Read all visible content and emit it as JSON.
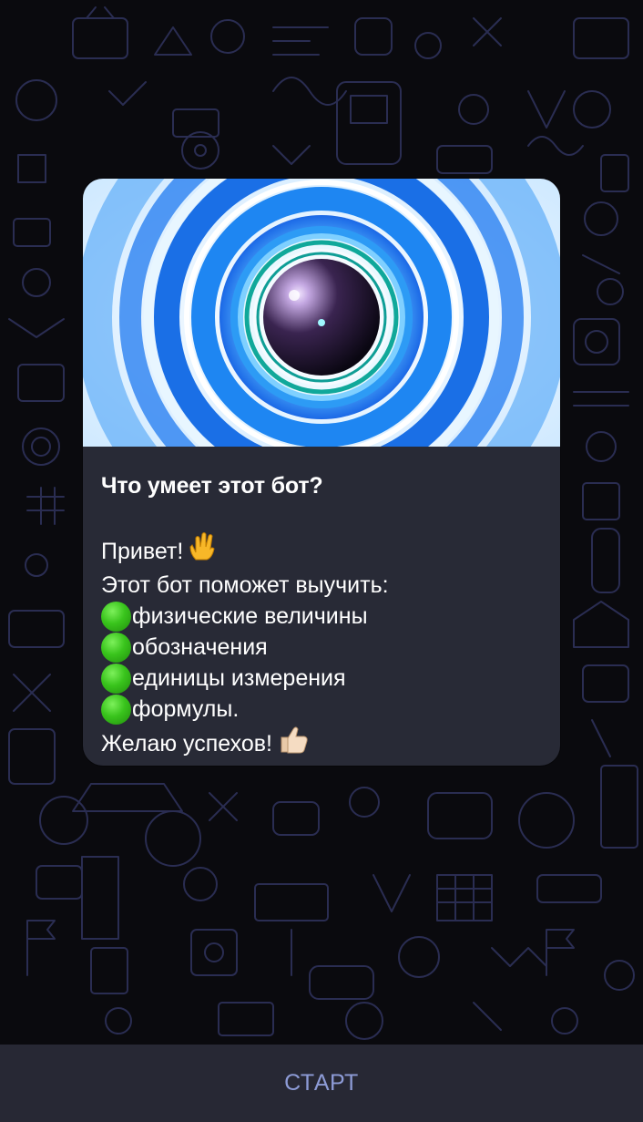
{
  "colors": {
    "background": "#0a0a0e",
    "card": "#282a36",
    "bottom_bar": "#272834",
    "start_text": "#8d9bd6",
    "bullet_green": "#39c41c"
  },
  "card": {
    "image_icon": "blue-concentric-rings-orb-image",
    "title": "Что умеет этот бот?",
    "greeting": "Привет!",
    "greeting_emoji": "vulcan-salute-icon",
    "intro": "Этот бот поможет выучить:",
    "items": [
      "физические величины",
      "обозначения",
      "единицы измерения",
      "формулы."
    ],
    "farewell": "Желаю успехов!",
    "farewell_emoji": "thumbs-up-icon"
  },
  "bottom": {
    "start_label": "СТАРТ"
  }
}
